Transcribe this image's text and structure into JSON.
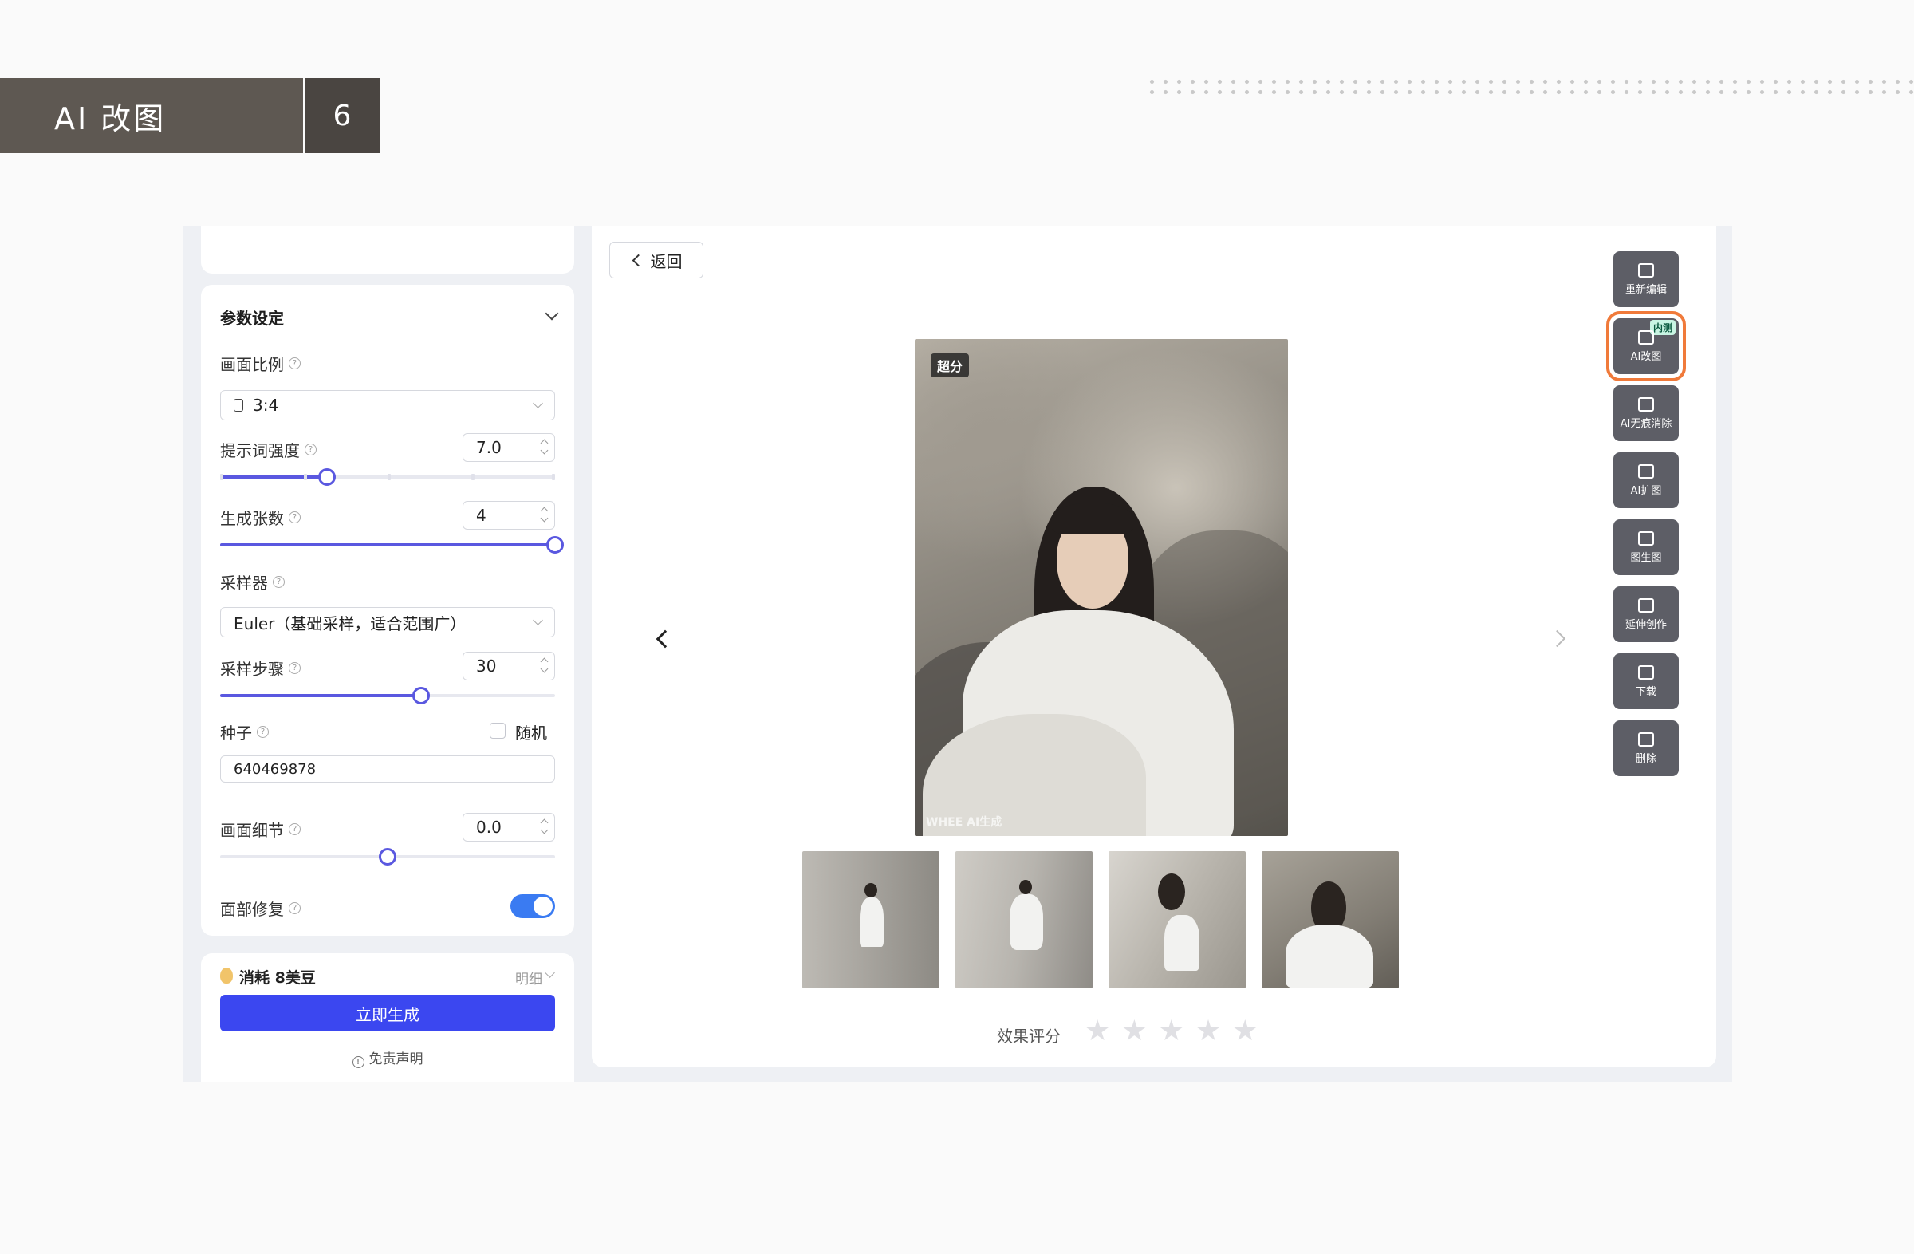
{
  "slide": {
    "title": "AI 改图",
    "number": "6"
  },
  "params": {
    "header": "参数设定",
    "ratio": {
      "label": "画面比例",
      "value": "3:4"
    },
    "prompt_strength": {
      "label": "提示词强度",
      "value": "7.0",
      "level": 0.32
    },
    "count": {
      "label": "生成张数",
      "value": "4",
      "level": 1.0
    },
    "sampler": {
      "label": "采样器",
      "value": "Euler（基础采样，适合范围广）"
    },
    "steps": {
      "label": "采样步骤",
      "value": "30",
      "level": 0.6
    },
    "seed": {
      "label": "种子",
      "random_label": "随机",
      "value": "640469878"
    },
    "detail": {
      "label": "画面细节",
      "value": "0.0",
      "level": 0.5
    },
    "face_fix": {
      "label": "面部修复",
      "on": true
    }
  },
  "footer": {
    "cost": "消耗 8美豆",
    "detail_label": "明细",
    "generate_label": "立即生成",
    "disclaimer": "免责声明"
  },
  "main": {
    "back_label": "返回",
    "badge": "超分",
    "watermark": "WHEE AI生成",
    "rating_label": "效果评分",
    "rating_stars": 5,
    "thumbnail_count": 4
  },
  "tools": [
    {
      "label": "重新编辑",
      "icon": "image-edit-icon"
    },
    {
      "label": "AI改图",
      "icon": "magic-brush-icon",
      "tag": "内测",
      "active": true
    },
    {
      "label": "AI无痕消除",
      "icon": "eraser-icon"
    },
    {
      "label": "AI扩图",
      "icon": "expand-icon"
    },
    {
      "label": "图生图",
      "icon": "image-to-image-icon"
    },
    {
      "label": "延伸创作",
      "icon": "extend-icon"
    },
    {
      "label": "下载",
      "icon": "download-icon"
    },
    {
      "label": "删除",
      "icon": "trash-icon"
    }
  ],
  "colors": {
    "accent": "#3b47f0",
    "slider": "#5a58e0",
    "toggle": "#3a7bf2",
    "highlight": "#f07a3a"
  }
}
